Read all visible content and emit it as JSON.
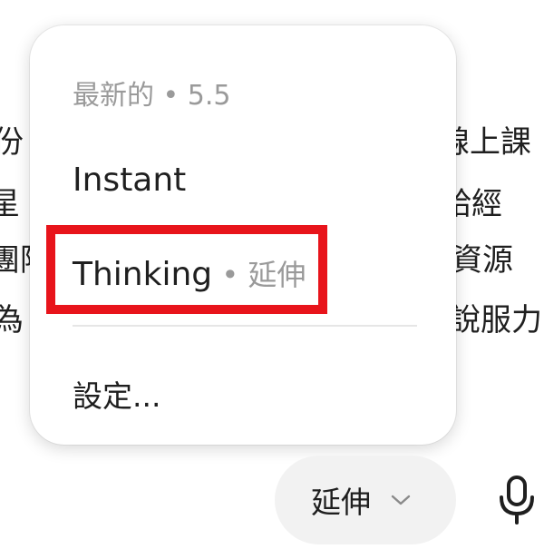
{
  "background_text": {
    "left": [
      "份",
      "星",
      "團隊",
      "為",
      "。"
    ],
    "right": [
      "線上課",
      "給經",
      "資源",
      "說服力"
    ]
  },
  "menu": {
    "header": "最新的 • 5.5",
    "items": [
      {
        "label": "Instant",
        "sub": ""
      },
      {
        "label": "Thinking",
        "sub": " • 延伸"
      }
    ],
    "settings_label": "設定..."
  },
  "controls": {
    "mode_label": "延伸",
    "chevron_icon": "chevron-down-icon",
    "mic_icon": "microphone-icon"
  },
  "colors": {
    "highlight": "#e8141b",
    "muted": "#9a9a9a"
  }
}
